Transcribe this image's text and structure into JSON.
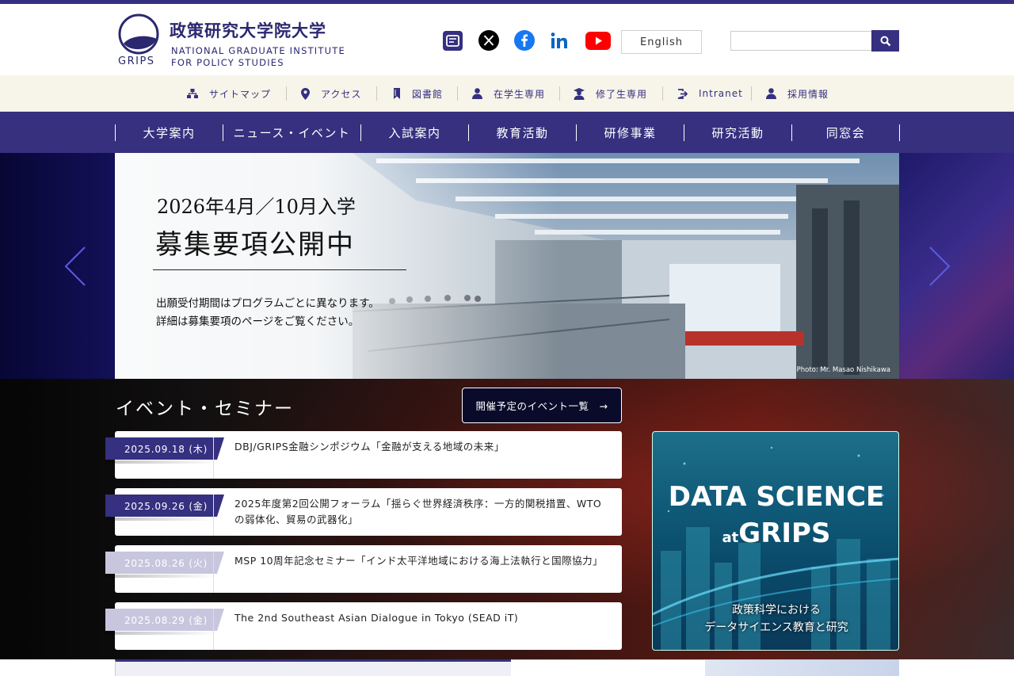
{
  "header": {
    "logo": {
      "grips": "GRIPS",
      "jp": "政策研究大学院大学",
      "en1": "NATIONAL GRADUATE INSTITUTE",
      "en2": "FOR POLICY STUDIES"
    },
    "social": [
      "newsletter-icon",
      "x-icon",
      "facebook-icon",
      "linkedin-icon",
      "youtube-icon"
    ],
    "english_label": "English",
    "search": {
      "value": "",
      "placeholder": ""
    }
  },
  "utility": [
    {
      "label": "サイトマップ",
      "icon": "sitemap-icon"
    },
    {
      "label": "アクセス",
      "icon": "map-pin-icon"
    },
    {
      "label": "図書館",
      "icon": "bookmark-icon"
    },
    {
      "label": "在学生専用",
      "icon": "student-icon"
    },
    {
      "label": "修了生専用",
      "icon": "graduate-icon"
    },
    {
      "label": "Intranet",
      "icon": "login-icon"
    },
    {
      "label": "採用情報",
      "icon": "person-icon"
    }
  ],
  "nav": [
    "大学案内",
    "ニュース・イベント",
    "入試案内",
    "教育活動",
    "研修事業",
    "研究活動",
    "同窓会"
  ],
  "hero": {
    "line1": "2026年4月／10月入学",
    "line2": "募集要項公開中",
    "line3": "出願受付期間はプログラムごとに異なります。",
    "line4": "詳細は募集要項のページをご覧ください。",
    "credit": "Photo: Mr. Masao Nishikawa"
  },
  "events": {
    "title": "イベント・セミナー",
    "button_label": "開催予定のイベント一覧　→",
    "items": [
      {
        "date": "2025.09.18 (木)",
        "title": "DBJ/GRIPS金融シンポジウム「金融が支える地域の未来」",
        "status": "upcoming"
      },
      {
        "date": "2025.09.26 (金)",
        "title": "2025年度第2回公開フォーラム「揺らぐ世界経済秩序：一方的関税措置、WTOの弱体化、貿易の武器化」",
        "status": "upcoming"
      },
      {
        "date": "2025.08.26 (火)",
        "title": "MSP 10周年記念セミナー「インド太平洋地域における海上法執行と国際協力」",
        "status": "past"
      },
      {
        "date": "2025.08.29 (金)",
        "title": "The 2nd Southeast Asian Dialogue in Tokyo (SEAD iT)",
        "status": "past"
      }
    ]
  },
  "banner": {
    "line1": "DATA SCIENCE",
    "line2_small": "at",
    "line2": "GRIPS",
    "jp1": "政策科学における",
    "jp2": "データサイエンス教育と研究"
  },
  "colors": {
    "primary": "#35307f",
    "utility_bg": "#f7f4ea"
  }
}
